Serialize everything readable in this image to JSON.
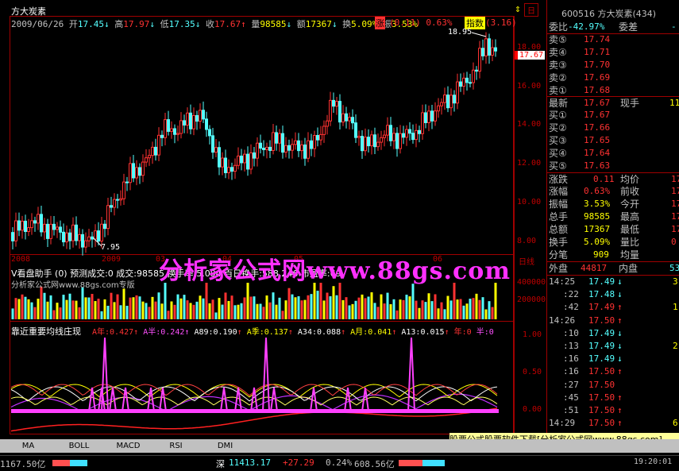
{
  "stock": {
    "name": "方大炭素",
    "code": "600516",
    "code_name": "600516  方大炭素(434)"
  },
  "header": {
    "date": "2009/06/26",
    "open_label": "开",
    "open": "17.45",
    "high_label": "高",
    "high": "17.97",
    "low_label": "低",
    "low": "17.35",
    "close_label": "收",
    "close": "17.67",
    "vol_label": "量",
    "vol": "98585",
    "amt_label": "额",
    "amt": "17367",
    "turn_label": "换",
    "turn": "5.09%",
    "amp_label": "振",
    "amp": "3.53%",
    "chg_label": "涨",
    "chg": "(0.11)",
    "chgpct": "0.63%",
    "idx_label": "指数",
    "idx": "(3.16)",
    "day_label": "日"
  },
  "price_axis": [
    "18.00",
    "16.00",
    "14.00",
    "12.00",
    "10.00",
    "8.00"
  ],
  "price_marks": {
    "high": "18.95",
    "low": "7.95",
    "current": "17.67"
  },
  "months": [
    "2008",
    "2009",
    "03",
    "04",
    "05",
    "06",
    "日线"
  ],
  "vol_title": "V看盘助手 (0)  预测成交:0  成交:98585 换手率:5.094 百日换手:588.246   市盈率:69.",
  "vol_axis": [
    "400000",
    "200000"
  ],
  "watermark_small": "分析家公式网www.88gs.com专版",
  "watermark_big": "分析家公式网www.88gs.com",
  "ind_title": "靠近重要均线庄现",
  "ind_values": [
    "A年:0.427",
    "A半:0.242",
    "A89:0.190",
    "A季:0.137",
    "A34:0.088",
    "A月:0.041",
    "A13:0.015",
    "年:0",
    "半:0"
  ],
  "ind_axis": [
    "1.00",
    "0.50",
    "0.00"
  ],
  "tabs": [
    "MA",
    "BOLL",
    "MACD",
    "RSI",
    "DMI"
  ],
  "right": {
    "wei_bi_label": "委比",
    "wei_bi": "-42.97%",
    "wei_cha_label": "委差",
    "wei_cha": "-",
    "asks": [
      {
        "l": "卖⑤",
        "p": "17.74"
      },
      {
        "l": "卖④",
        "p": "17.71"
      },
      {
        "l": "卖③",
        "p": "17.70"
      },
      {
        "l": "卖②",
        "p": "17.69"
      },
      {
        "l": "卖①",
        "p": "17.68"
      }
    ],
    "last_label": "最新",
    "last": "17.67",
    "cur_label": "现手",
    "cur": "11",
    "bids": [
      {
        "l": "买①",
        "p": "17.67"
      },
      {
        "l": "买②",
        "p": "17.66"
      },
      {
        "l": "买③",
        "p": "17.65"
      },
      {
        "l": "买④",
        "p": "17.64"
      },
      {
        "l": "买⑤",
        "p": "17.63"
      }
    ],
    "stats": [
      {
        "a": "涨跌",
        "b": "0.11",
        "c": "均价",
        "d": "17"
      },
      {
        "a": "涨幅",
        "b": "0.63%",
        "c": "前收",
        "d": "17"
      },
      {
        "a": "振幅",
        "b": "3.53%",
        "c": "今开",
        "d": "17"
      },
      {
        "a": "总手",
        "b": "98585",
        "c": "最高",
        "d": "17"
      },
      {
        "a": "总额",
        "b": "17367",
        "c": "最低",
        "d": "17"
      },
      {
        "a": "换手",
        "b": "5.09%",
        "c": "量比",
        "d": "0"
      },
      {
        "a": "分笔",
        "b": "909",
        "c": "均量",
        "d": ""
      }
    ],
    "outer_label": "外盘",
    "outer": "44817",
    "inner_label": "内盘",
    "inner": "53",
    "ticks": [
      {
        "t": "14:25",
        "p": "17.49",
        "a": "↓"
      },
      {
        "t": ":22",
        "p": "17.48",
        "a": "↓"
      },
      {
        "t": ":42",
        "p": "17.49",
        "a": "↑"
      },
      {
        "t": "14:26",
        "p": "17.50",
        "a": "↑"
      },
      {
        "t": ":10",
        "p": "17.49",
        "a": "↓"
      },
      {
        "t": ":13",
        "p": "17.49",
        "a": "↓"
      },
      {
        "t": ":16",
        "p": "17.49",
        "a": "↓"
      },
      {
        "t": ":16",
        "p": "17.50",
        "a": "↑"
      },
      {
        "t": ":27",
        "p": "17.50",
        "a": ""
      },
      {
        "t": ":45",
        "p": "17.50",
        "a": "↑"
      },
      {
        "t": ":51",
        "p": "17.50",
        "a": "↑"
      },
      {
        "t": "14:29",
        "p": "17.50",
        "a": "↑"
      }
    ],
    "right_nums": [
      "3",
      "",
      "1",
      "",
      "",
      "2",
      "",
      "",
      "",
      "",
      "",
      "6"
    ]
  },
  "ad_banner": "股票公式股票软件下载[分析家公式网www.88gs.com]",
  "status": {
    "sh": "1167.50亿",
    "sz_label": "深",
    "sz": "11413.17",
    "sz_chg": "+27.29",
    "sz_pct": "0.24%",
    "sz_amt": "608.56亿",
    "time": "19:20:01"
  }
}
